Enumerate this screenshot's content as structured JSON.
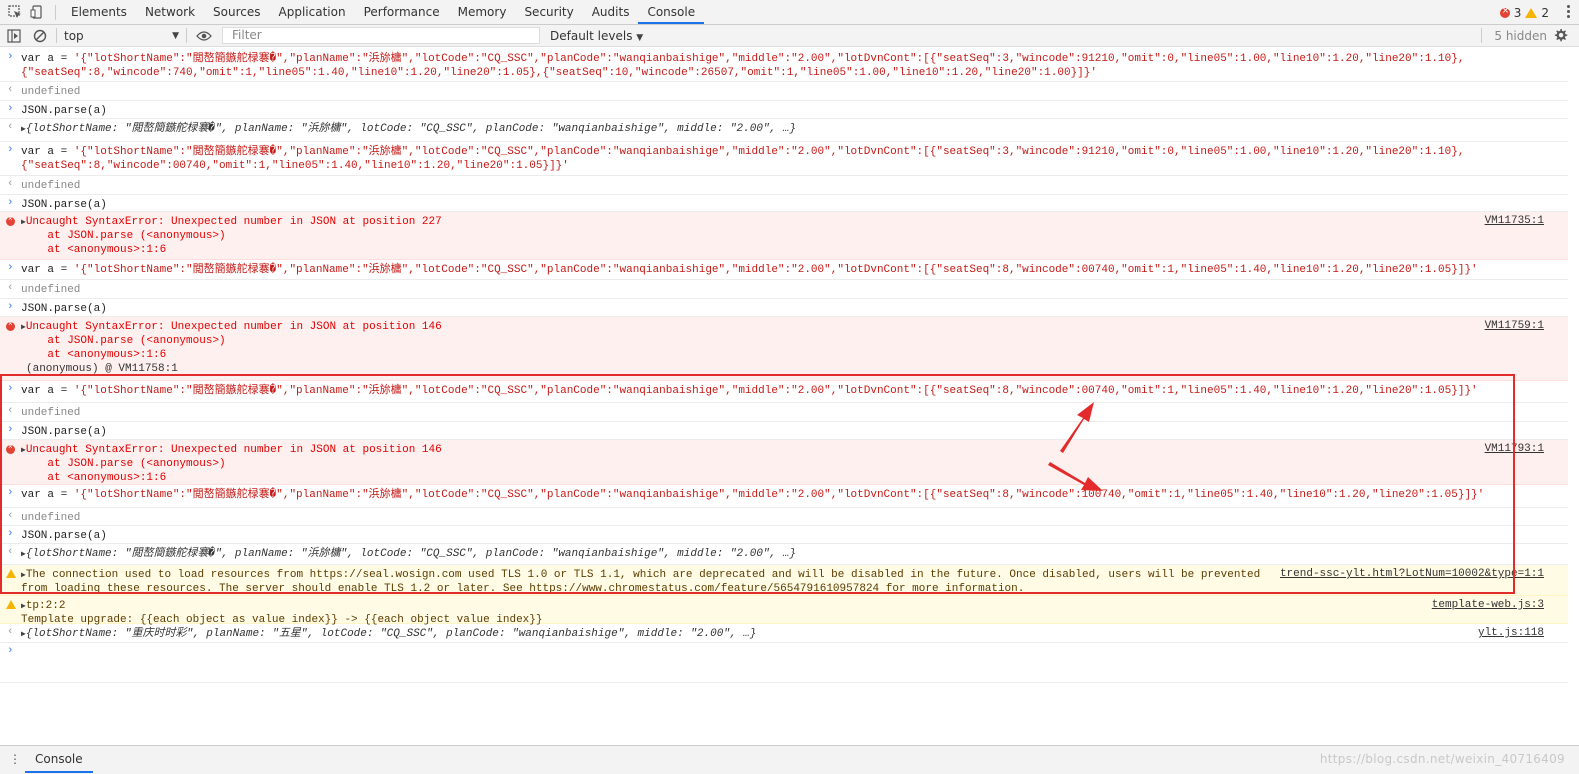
{
  "tabs": [
    "Elements",
    "Network",
    "Sources",
    "Application",
    "Performance",
    "Memory",
    "Security",
    "Audits",
    "Console"
  ],
  "active_tab": "Console",
  "counts": {
    "errors": "3",
    "warnings": "2"
  },
  "toolbar": {
    "context": "top",
    "filter_placeholder": "Filter",
    "levels": "Default levels",
    "hidden": "5 hidden"
  },
  "rows": [
    {
      "prefix": ">",
      "l1": "var a = '{\"lotShortName\":\"閲嶅簡鏃舵椂褰�\",\"planName\":\"浜旀槦\",\"lotCode\":\"CQ_SSC\",\"planCode\":\"wanqianbaishige\",\"middle\":\"2.00\",\"lotDvnCont\":[{\"seatSeq\":3,\"wincode\":91210,\"omit\":0,\"line05\":1.00,\"line10\":1.20,\"line20\":1.10},",
      "l2": "{\"seatSeq\":8,\"wincode\":740,\"omit\":1,\"line05\":1.40,\"line10\":1.20,\"line20\":1.05},{\"seatSeq\":10,\"wincode\":26507,\"omit\":1,\"line05\":1.00,\"line10\":1.20,\"line20\":1.00}]}'"
    },
    {
      "prefix": "<",
      "l1": "undefined"
    },
    {
      "prefix": ">",
      "l1": "JSON.parse(a)"
    },
    {
      "prefix": "<",
      "l1": "{lotShortName: \"閲嶅簡鏃舵椂褰�\", planName: \"浜旀槦\", lotCode: \"CQ_SSC\", planCode: \"wanqianbaishige\", middle: \"2.00\", …}"
    },
    {
      "prefix": ">",
      "l1": "var a = '{\"lotShortName\":\"閲嶅簡鏃舵椂褰�\",\"planName\":\"浜旀槦\",\"lotCode\":\"CQ_SSC\",\"planCode\":\"wanqianbaishige\",\"middle\":\"2.00\",\"lotDvnCont\":[{\"seatSeq\":3,\"wincode\":91210,\"omit\":0,\"line05\":1.00,\"line10\":1.20,\"line20\":1.10},",
      "l2": "{\"seatSeq\":8,\"wincode\":00740,\"omit\":1,\"line05\":1.40,\"line10\":1.20,\"line20\":1.05}]}'"
    },
    {
      "prefix": "<",
      "l1": "undefined"
    },
    {
      "prefix": ">",
      "l1": "JSON.parse(a)"
    },
    {
      "prefix": "error",
      "l1": "Uncaught SyntaxError: Unexpected number in JSON at position 227",
      "l2": "    at JSON.parse (<anonymous>)",
      "l3": "    at <anonymous>:1:6",
      "src": "VM11735:1"
    },
    {
      "prefix": ">",
      "l1": "var a = '{\"lotShortName\":\"閲嶅簡鏃舵椂褰�\",\"planName\":\"浜旀槦\",\"lotCode\":\"CQ_SSC\",\"planCode\":\"wanqianbaishige\",\"middle\":\"2.00\",\"lotDvnCont\":[{\"seatSeq\":8,\"wincode\":00740,\"omit\":1,\"line05\":1.40,\"line10\":1.20,\"line20\":1.05}]}'"
    },
    {
      "prefix": "<",
      "l1": "undefined"
    },
    {
      "prefix": ">",
      "l1": "JSON.parse(a)"
    },
    {
      "prefix": "error",
      "l1": "Uncaught SyntaxError: Unexpected number in JSON at position 146",
      "l2": "    at JSON.parse (<anonymous>)",
      "l3": "    at <anonymous>:1:6",
      "l4": "(anonymous) @ VM11758:1",
      "src": "VM11759:1"
    },
    {
      "prefix": ">",
      "l1": "var a = '{\"lotShortName\":\"閲嶅簡鏃舵椂褰�\",\"planName\":\"浜旀槦\",\"lotCode\":\"CQ_SSC\",\"planCode\":\"wanqianbaishige\",\"middle\":\"2.00\",\"lotDvnCont\":[{\"seatSeq\":8,\"wincode\":00740,\"omit\":1,\"line05\":1.40,\"line10\":1.20,\"line20\":1.05}]}'"
    },
    {
      "prefix": "<",
      "l1": "undefined"
    },
    {
      "prefix": ">",
      "l1": "JSON.parse(a)"
    },
    {
      "prefix": "error",
      "l1": "Uncaught SyntaxError: Unexpected number in JSON at position 146",
      "l2": "    at JSON.parse (<anonymous>)",
      "l3": "    at <anonymous>:1:6",
      "src": "VM11793:1"
    },
    {
      "prefix": ">",
      "l1": "var a = '{\"lotShortName\":\"閲嶅簡鏃舵椂褰�\",\"planName\":\"浜旀槦\",\"lotCode\":\"CQ_SSC\",\"planCode\":\"wanqianbaishige\",\"middle\":\"2.00\",\"lotDvnCont\":[{\"seatSeq\":8,\"wincode\":100740,\"omit\":1,\"line05\":1.40,\"line10\":1.20,\"line20\":1.05}]}'"
    },
    {
      "prefix": "<",
      "l1": "undefined"
    },
    {
      "prefix": ">",
      "l1": "JSON.parse(a)"
    },
    {
      "prefix": "<",
      "l1": "{lotShortName: \"閲嶅簡鏃舵椂褰�\", planName: \"浜旀槦\", lotCode: \"CQ_SSC\", planCode: \"wanqianbaishige\", middle: \"2.00\", …}"
    },
    {
      "prefix": "warn",
      "l1": "The connection used to load resources from https://seal.wosign.com used TLS 1.0 or TLS 1.1, which are deprecated and will be disabled in the future. Once disabled, users will be prevented",
      "l2": "from loading these resources. The server should enable TLS 1.2 or later. See https://www.chromestatus.com/feature/5654791610957824 for more information.",
      "src": "trend-ssc-ylt.html?LotNum=10002&type=1:1"
    },
    {
      "prefix": "warn",
      "l1": "tp:2:2",
      "l2": "Template upgrade: {{each object as value index}} -> {{each object value index}}",
      "src": "template-web.js:3"
    },
    {
      "prefix": "<",
      "l1": "{lotShortName: \"重庆时时彩\", planName: \"五星\", lotCode: \"CQ_SSC\", planCode: \"wanqianbaishige\", middle: \"2.00\", …}",
      "src": "ylt.js:118"
    },
    {
      "prefix": ">",
      "l1": ""
    }
  ],
  "drawer": {
    "tab": "Console"
  },
  "watermark": "https://blog.csdn.net/weixin_40716409"
}
